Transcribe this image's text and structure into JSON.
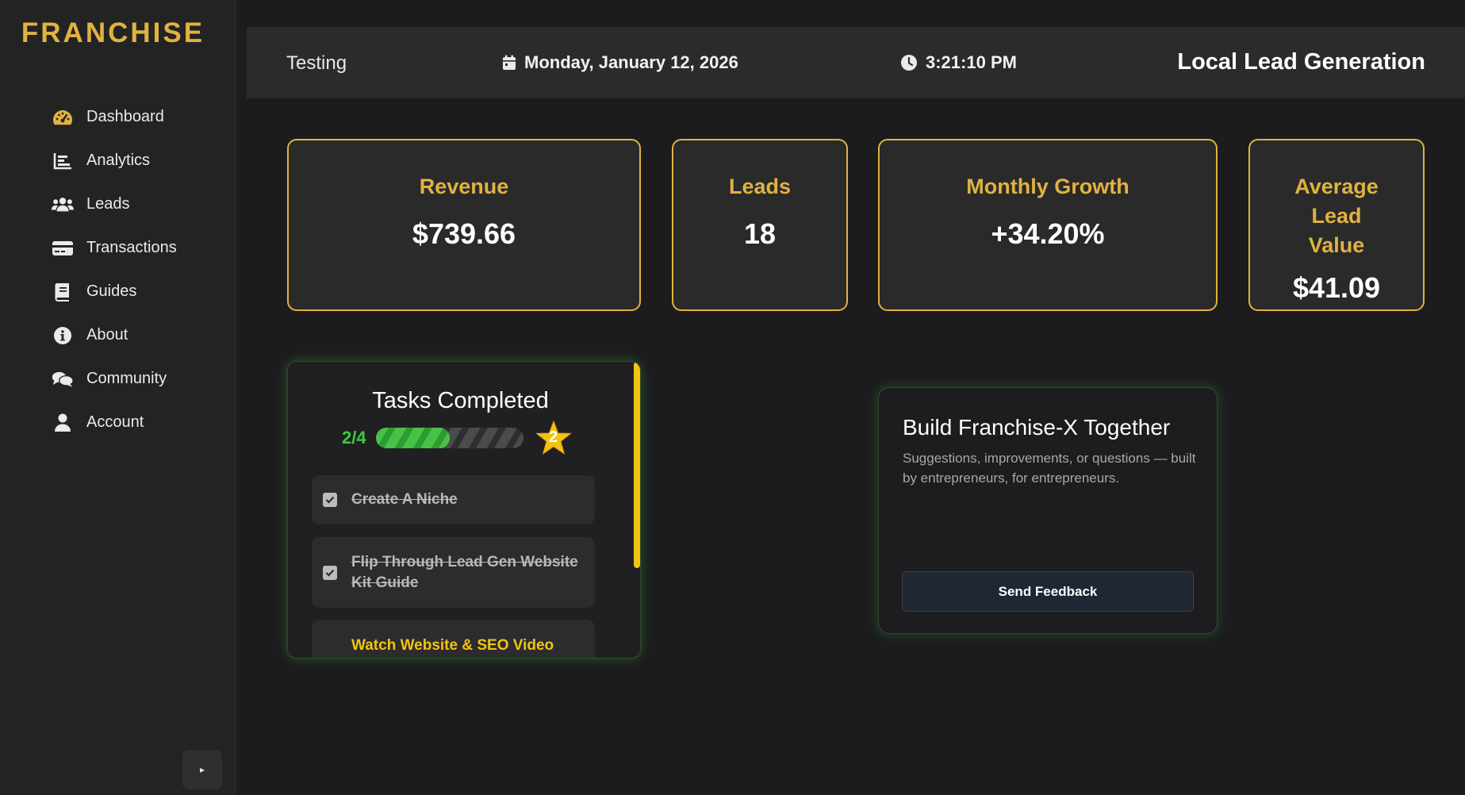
{
  "brand": "FRANCHISE",
  "colors": {
    "accent": "#e0b23f",
    "progress": "#3ccc3c",
    "task_pending": "#f2c40f",
    "glow": "#3cc846"
  },
  "sidebar": {
    "items": [
      {
        "label": "Dashboard",
        "icon": "gauge-icon"
      },
      {
        "label": "Analytics",
        "icon": "bar-chart-icon"
      },
      {
        "label": "Leads",
        "icon": "users-icon"
      },
      {
        "label": "Transactions",
        "icon": "credit-card-icon"
      },
      {
        "label": "Guides",
        "icon": "book-icon"
      },
      {
        "label": "About",
        "icon": "info-icon"
      },
      {
        "label": "Community",
        "icon": "comments-icon"
      },
      {
        "label": "Account",
        "icon": "user-icon"
      }
    ],
    "collapse_label": "▸"
  },
  "header": {
    "workspace": "Testing",
    "date": "Monday, January 12, 2026",
    "time": "3:21:10 PM",
    "title": "Local Lead Generation"
  },
  "stats": [
    {
      "label": "Revenue",
      "value": "$739.66"
    },
    {
      "label": "Leads",
      "value": "18"
    },
    {
      "label": "Monthly Growth",
      "value": "+34.20%"
    },
    {
      "label": "Average Lead Value",
      "value": "$41.09"
    }
  ],
  "tasks": {
    "title": "Tasks Completed",
    "progress_text": "2/4",
    "completed": 2,
    "total": 4,
    "badge": "2",
    "items": [
      {
        "text": "Create A Niche",
        "done": true
      },
      {
        "text": "Flip Through Lead Gen Website Kit Guide",
        "done": true
      },
      {
        "text": "Watch Website & SEO Video",
        "done": false
      }
    ]
  },
  "feedback": {
    "title": "Build Franchise-X Together",
    "description": "Suggestions, improvements, or questions — built by entrepreneurs, for entrepreneurs.",
    "button_label": "Send Feedback"
  }
}
